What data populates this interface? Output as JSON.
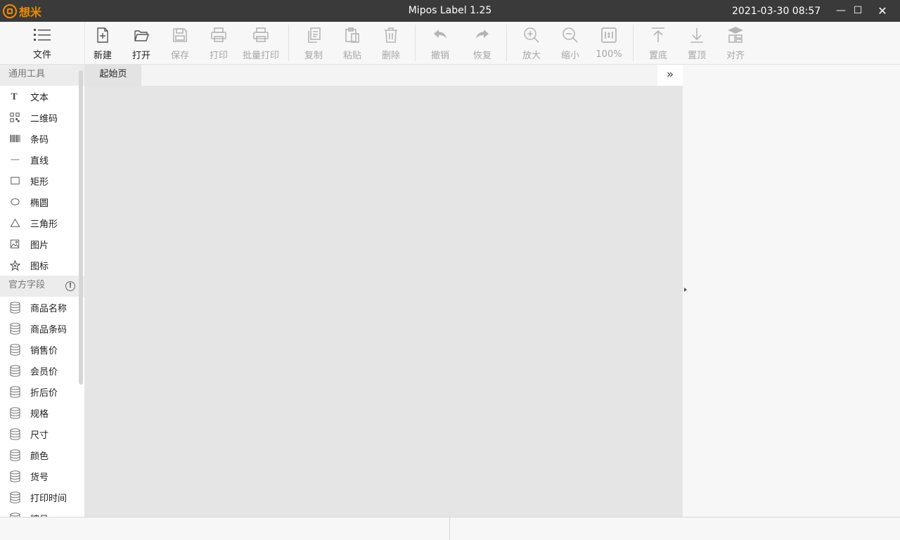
{
  "window": {
    "logo_text": "想米",
    "title": "Mipos Label 1.25",
    "datetime": "2021-03-30 08:57",
    "minimize_glyph": "—",
    "maximize_glyph": "☐",
    "close_glyph": "✕"
  },
  "toolbar": {
    "file": "文件",
    "new": "新建",
    "open": "打开",
    "save": "保存",
    "print": "打印",
    "batch_print": "批量打印",
    "copy": "复制",
    "paste": "粘贴",
    "delete": "删除",
    "undo": "撤销",
    "redo": "恢复",
    "zoom_in": "放大",
    "zoom_out": "缩小",
    "zoom_level": "100%",
    "send_to_back": "置底",
    "bring_to_front": "置顶",
    "align": "对齐"
  },
  "sidebar": {
    "general_header": "通用工具",
    "general_items": [
      {
        "label": "文本",
        "icon": "text-icon"
      },
      {
        "label": "二维码",
        "icon": "qrcode-icon"
      },
      {
        "label": "条码",
        "icon": "barcode-icon"
      },
      {
        "label": "直线",
        "icon": "line-icon"
      },
      {
        "label": "矩形",
        "icon": "rectangle-icon"
      },
      {
        "label": "椭圆",
        "icon": "ellipse-icon"
      },
      {
        "label": "三角形",
        "icon": "triangle-icon"
      },
      {
        "label": "图片",
        "icon": "image-icon"
      },
      {
        "label": "图标",
        "icon": "star-icon"
      }
    ],
    "fields_header": "官方字段",
    "fields_info_glyph": "!",
    "field_items": [
      {
        "label": "商品名称",
        "icon": "database-icon"
      },
      {
        "label": "商品条码",
        "icon": "database-icon"
      },
      {
        "label": "销售价",
        "icon": "database-icon"
      },
      {
        "label": "会员价",
        "icon": "database-icon"
      },
      {
        "label": "折后价",
        "icon": "database-icon"
      },
      {
        "label": "规格",
        "icon": "database-icon"
      },
      {
        "label": "尺寸",
        "icon": "database-icon"
      },
      {
        "label": "颜色",
        "icon": "database-icon"
      },
      {
        "label": "货号",
        "icon": "database-icon"
      },
      {
        "label": "打印时间",
        "icon": "database-icon"
      },
      {
        "label": "牌号",
        "icon": "database-icon"
      }
    ]
  },
  "tabs": {
    "start": "起始页",
    "expand_glyph": "»"
  },
  "colors": {
    "titlebar": "#3a3a3a",
    "brand": "#f08c00",
    "canvas": "#e5e5e5"
  }
}
